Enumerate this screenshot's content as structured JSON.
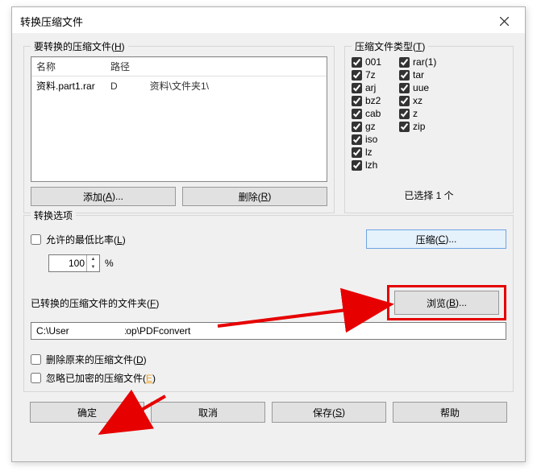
{
  "window": {
    "title": "转换压缩文件"
  },
  "files": {
    "group_label_pre": "要转换的压缩文件(",
    "group_label_hot": "H",
    "group_label_post": ")",
    "col_name": "名称",
    "col_path": "路径",
    "rows": [
      {
        "name": "资料.part1.rar",
        "path_pre": "D",
        "path_post": "资料\\文件夹1\\"
      }
    ],
    "add_pre": "添加(",
    "add_hot": "A",
    "add_post": ")...",
    "del_pre": "删除(",
    "del_hot": "R",
    "del_post": ")"
  },
  "types": {
    "group_label_pre": "压缩文件类型(",
    "group_label_hot": "T",
    "group_label_post": ")",
    "col1": [
      "001",
      "7z",
      "arj",
      "bz2",
      "cab",
      "gz",
      "iso",
      "lz",
      "lzh"
    ],
    "col2": [
      "rar(1)",
      "tar",
      "uue",
      "xz",
      "z",
      "zip"
    ],
    "selected_count": "已选择 1 个"
  },
  "options": {
    "group_label": "转换选项",
    "min_ratio_pre": "允许的最低比率(",
    "min_ratio_hot": "L",
    "min_ratio_post": ")",
    "min_ratio_value": "100",
    "pct": "%",
    "compress_pre": "压缩(",
    "compress_hot": "C",
    "compress_post": ")...",
    "folder_label_pre": "已转换的压缩文件的文件夹(",
    "folder_label_hot": "F",
    "folder_label_post": ")",
    "browse_pre": "浏览(",
    "browse_hot": "B",
    "browse_post": ")...",
    "path_pre": "C:\\User",
    "path_post": "Desktop\\PDFconvert",
    "delete_orig_pre": "删除原来的压缩文件(",
    "delete_orig_hot": "D",
    "delete_orig_post": ")",
    "ignore_enc_pre": "忽略已加密的压缩文件(",
    "ignore_enc_hot": "E",
    "ignore_enc_post": ")"
  },
  "buttons": {
    "ok": "确定",
    "cancel": "取消",
    "save_pre": "保存(",
    "save_hot": "S",
    "save_post": ")",
    "help": "帮助"
  }
}
